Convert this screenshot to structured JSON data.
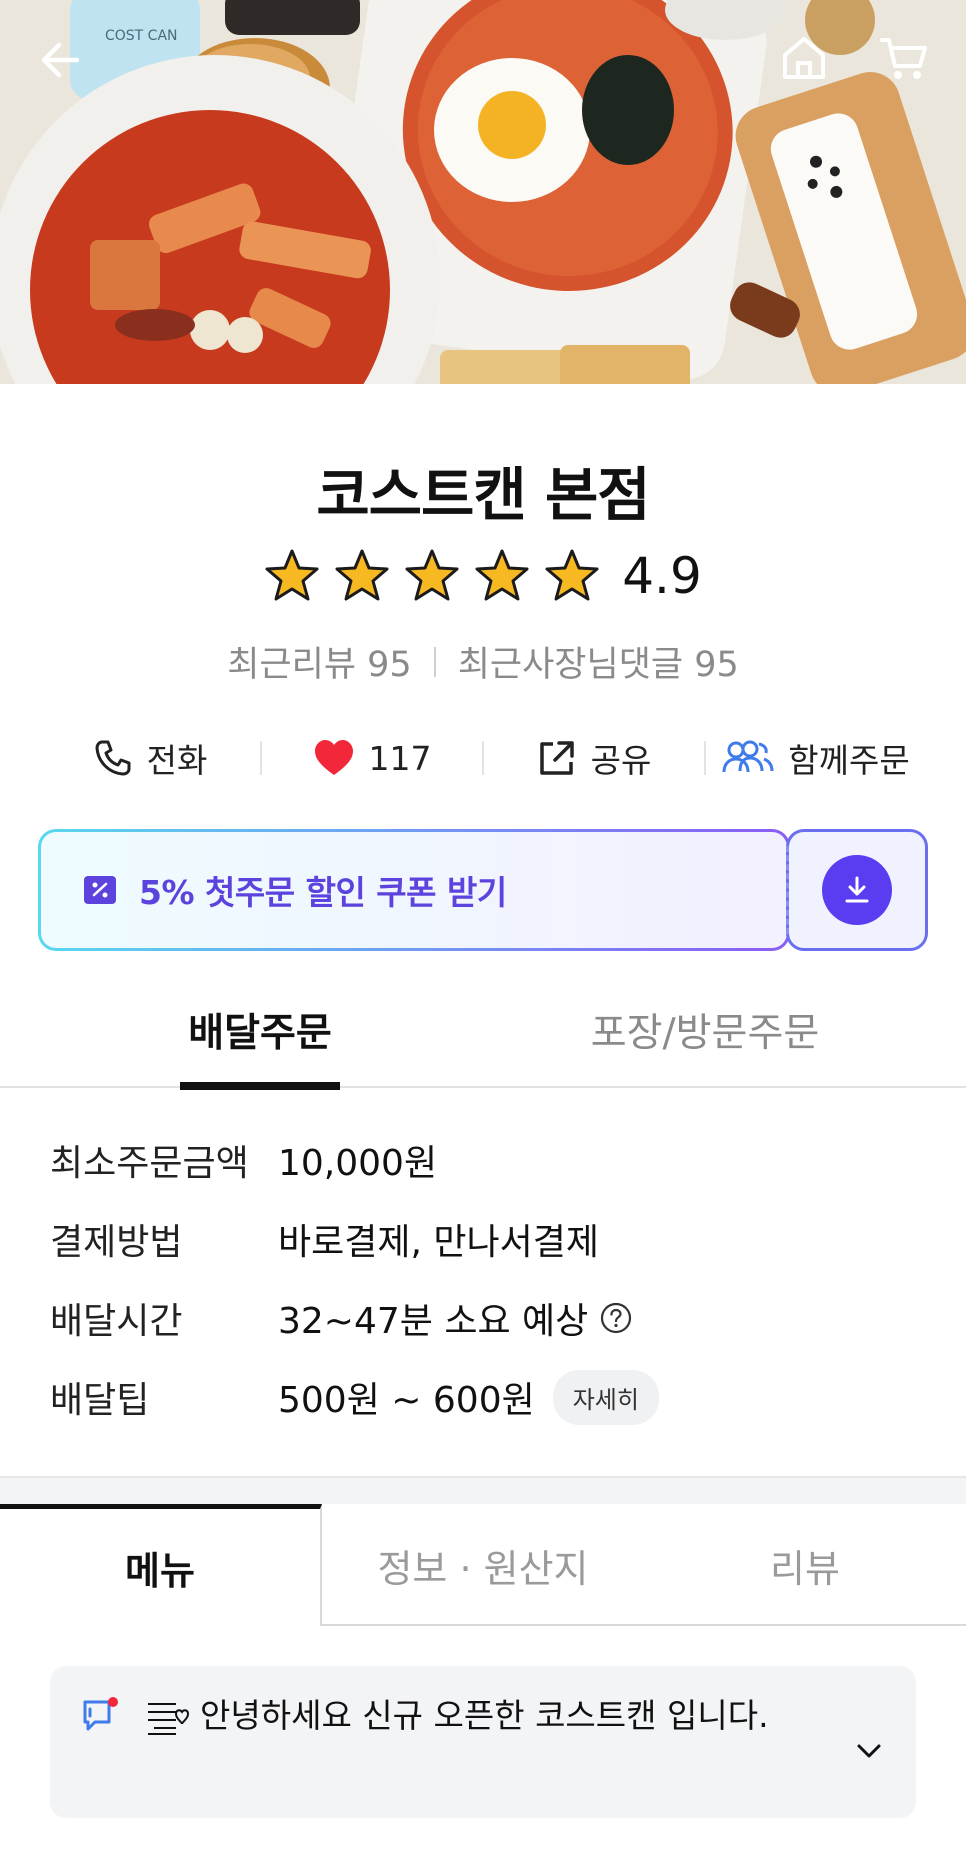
{
  "store": {
    "name": "코스트캔 본점",
    "rating": "4.9",
    "stars": 5,
    "recent_reviews": "최근리뷰 95",
    "recent_owner_replies": "최근사장님댓글 95"
  },
  "actions": {
    "call": "전화",
    "likes": "117",
    "share": "공유",
    "group_order": "함께주문"
  },
  "coupon": {
    "label": "5% 첫주문 할인 쿠폰 받기"
  },
  "order_tabs": {
    "delivery": "배달주문",
    "takeout": "포장/방문주문"
  },
  "info": {
    "min_order_label": "최소주문금액",
    "min_order_value": "10,000원",
    "payment_label": "결제방법",
    "payment_value": "바로결제, 만나서결제",
    "time_label": "배달시간",
    "time_value": "32~47분 소요 예상",
    "tip_label": "배달팁",
    "tip_value": "500원 ~ 600원",
    "tip_detail": "자세히"
  },
  "main_tabs": {
    "menu": "메뉴",
    "info": "정보 · 원산지",
    "review": "리뷰"
  },
  "notice": {
    "text": "안녕하세요 신규 오픈한 코스트캔 입니다."
  },
  "colors": {
    "accent_purple": "#5d43dd",
    "download_button": "#5a3df0",
    "heart": "#f2273a",
    "group_icon": "#3f7bea",
    "star": "#f6b921"
  }
}
